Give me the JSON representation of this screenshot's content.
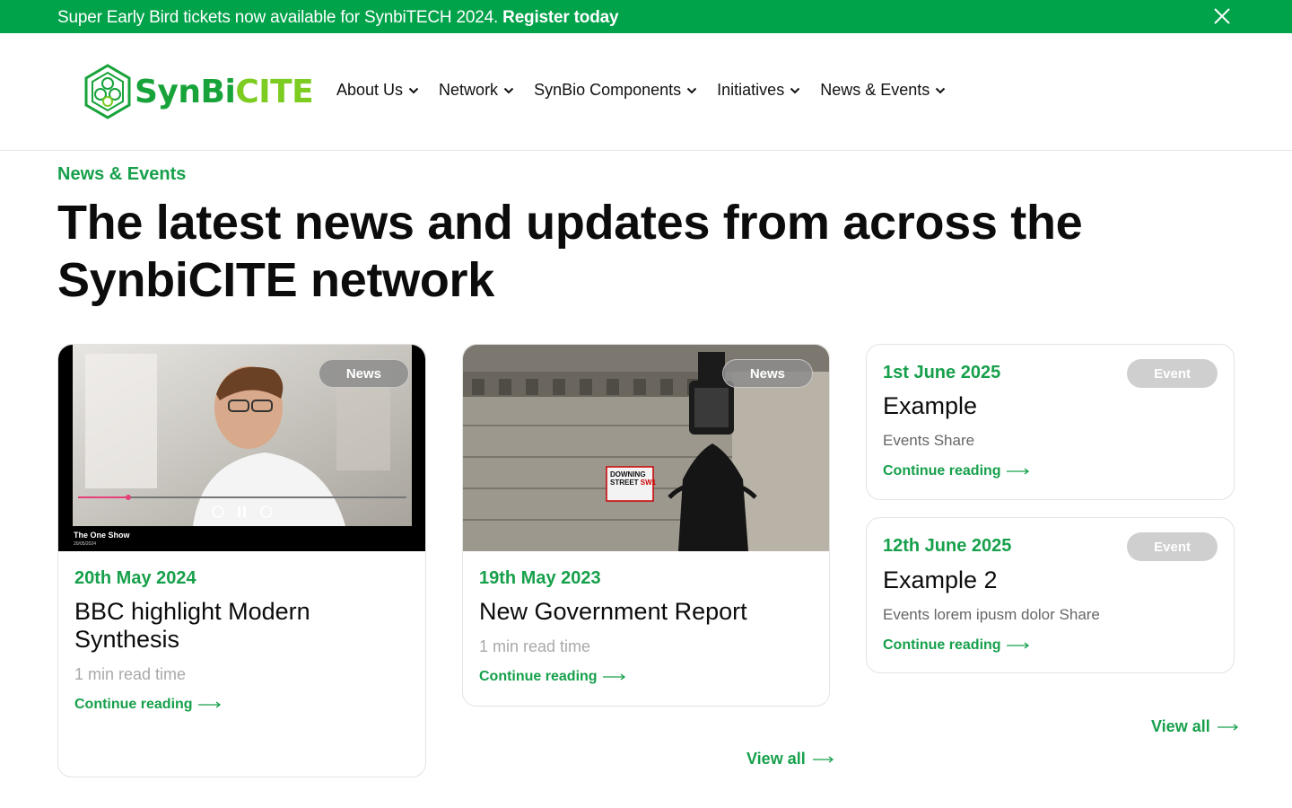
{
  "banner": {
    "text": "Super Early Bird tickets now available for SynbiTECH 2024.",
    "link": "Register today"
  },
  "logo": {
    "part1": "SynBi",
    "part2": "CITE"
  },
  "nav": [
    {
      "label": "About Us"
    },
    {
      "label": "Network"
    },
    {
      "label": "SynBio Components"
    },
    {
      "label": "Initiatives"
    },
    {
      "label": "News & Events"
    }
  ],
  "section": {
    "eyebrow": "News & Events",
    "headline": "The latest news and updates from across the SynbiCITE network"
  },
  "news": [
    {
      "badge": "News",
      "date": "20th May 2024",
      "title": "BBC highlight Modern Synthesis",
      "meta": "1 min read time",
      "link": "Continue reading",
      "image_caption": "The One Show",
      "image_subcaption": "20/05/2024"
    },
    {
      "badge": "News",
      "date": "19th May 2023",
      "title": "New Government Report",
      "meta": "1 min read time",
      "link": "Continue reading",
      "sign_line1": "DOWNING",
      "sign_line2": "STREET",
      "sign_line3": "SW1"
    }
  ],
  "news_view_all": "View all",
  "events": [
    {
      "badge": "Event",
      "date": "1st June 2025",
      "title": "Example",
      "meta": "Events Share",
      "link": "Continue reading"
    },
    {
      "badge": "Event",
      "date": "12th June 2025",
      "title": "Example 2",
      "meta": "Events lorem ipusm dolor Share",
      "link": "Continue reading"
    }
  ],
  "events_view_all": "View all",
  "colors": {
    "brand_green": "#00a24a",
    "accent_green": "#16a04b",
    "lime": "#7ccc22",
    "badge_grey": "#cfcfcf"
  },
  "icons": [
    "close-icon",
    "chevron-down-icon",
    "arrow-right-icon",
    "hexagon-logo-icon"
  ]
}
